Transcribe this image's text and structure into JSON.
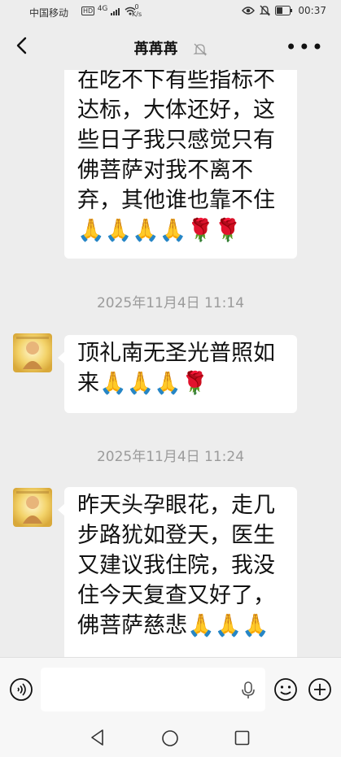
{
  "status_bar": {
    "carrier": "中国移动",
    "network_badge": "HD",
    "signal_label": "4G",
    "speed_value": "0",
    "speed_unit": "K/s",
    "time": "00:37",
    "icons": [
      "eye-icon",
      "mute-bell-icon",
      "battery-icon"
    ]
  },
  "header": {
    "title": "苒苒苒",
    "muted": true
  },
  "messages": [
    {
      "type": "text",
      "from": "other",
      "text": "在吃不下有些指标不达标，大体还好，这些日子我只感觉只有佛菩萨对我不离不弃，其他谁也靠不住🙏🙏🙏🙏🌹🌹"
    },
    {
      "type": "timestamp",
      "text": "2025年11月4日 11:14"
    },
    {
      "type": "text",
      "from": "other",
      "text": "顶礼南无圣光普照如来🙏🙏🙏🌹"
    },
    {
      "type": "timestamp",
      "text": "2025年11月4日 11:24"
    },
    {
      "type": "text",
      "from": "other",
      "text": "昨天头孕眼花，走几步路犹如登天，医生又建议我住院，我没住今天复查又好了，佛菩萨慈悲🙏🙏🙏"
    }
  ],
  "input": {
    "placeholder": ""
  },
  "colors": {
    "background": "#ededed",
    "bubble": "#ffffff",
    "timestamp": "#9b9b9b",
    "text": "#111111"
  }
}
